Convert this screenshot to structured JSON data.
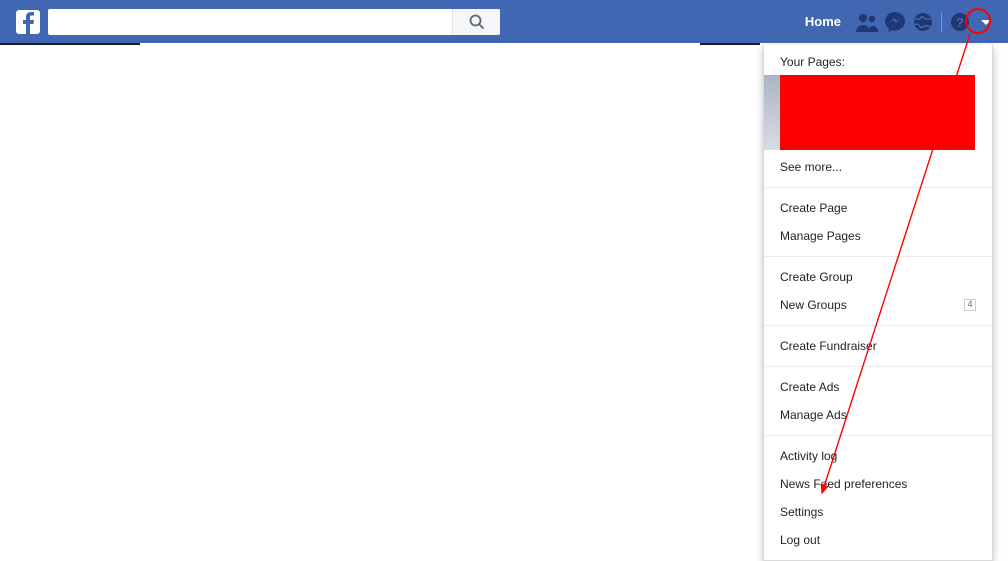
{
  "nav": {
    "home": "Home"
  },
  "search": {
    "placeholder": ""
  },
  "dropdown": {
    "pages_header": "Your Pages:",
    "see_more": "See more...",
    "create_page": "Create Page",
    "manage_pages": "Manage Pages",
    "create_group": "Create Group",
    "new_groups": "New Groups",
    "new_groups_badge": "4",
    "create_fundraiser": "Create Fundraiser",
    "create_ads": "Create Ads",
    "manage_ads": "Manage Ads",
    "activity_log": "Activity log",
    "news_feed_prefs": "News Feed preferences",
    "settings": "Settings",
    "log_out": "Log out"
  }
}
